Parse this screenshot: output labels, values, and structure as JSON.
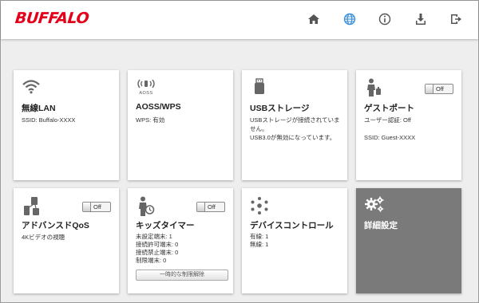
{
  "brand": {
    "logo_text": "BUFFALO",
    "color": "#e2001a"
  },
  "nav": {
    "items": [
      {
        "icon": "home-icon"
      },
      {
        "icon": "globe-icon",
        "color": "#3a8fd8"
      },
      {
        "icon": "info-icon"
      },
      {
        "icon": "download-icon"
      },
      {
        "icon": "logout-icon"
      }
    ]
  },
  "cards": {
    "wireless": {
      "icon": "wifi-icon",
      "title": "無線LAN",
      "lines": [
        "SSID: Buffalo-XXXX"
      ]
    },
    "aoss": {
      "icon": "aoss-icon",
      "icon_caption": "AOSS",
      "title": "AOSS/WPS",
      "lines": [
        "WPS: 有効"
      ]
    },
    "usb": {
      "icon": "usb-storage-icon",
      "title": "USBストレージ",
      "lines": [
        "USBストレージが接続されていま",
        "せん。",
        "USB3.0が無効になっています。"
      ]
    },
    "guest": {
      "icon": "guest-person-icon",
      "title": "ゲストポート",
      "toggle": "Off",
      "lines": [
        "ユーザー認証: Off",
        "",
        "SSID: Guest-XXXX"
      ]
    },
    "qos": {
      "icon": "qos-icon",
      "title": "アドバンスドQoS",
      "toggle": "Off",
      "lines": [
        "4Kビデオの視聴"
      ]
    },
    "kids": {
      "icon": "kids-timer-icon",
      "title": "キッズタイマー",
      "toggle": "Off",
      "lines": [
        "未設定端末: 1",
        "接続許可端末: 0",
        "接続禁止端末: 0",
        "制限端末: 0"
      ],
      "button": "一時的な制限解除"
    },
    "devices": {
      "icon": "device-control-icon",
      "title": "デバイスコントロール",
      "lines": [
        "有線: 1",
        "無線: 1"
      ]
    },
    "advanced": {
      "icon": "gears-icon",
      "title": "詳細設定",
      "background": "#7a7a7a"
    }
  }
}
